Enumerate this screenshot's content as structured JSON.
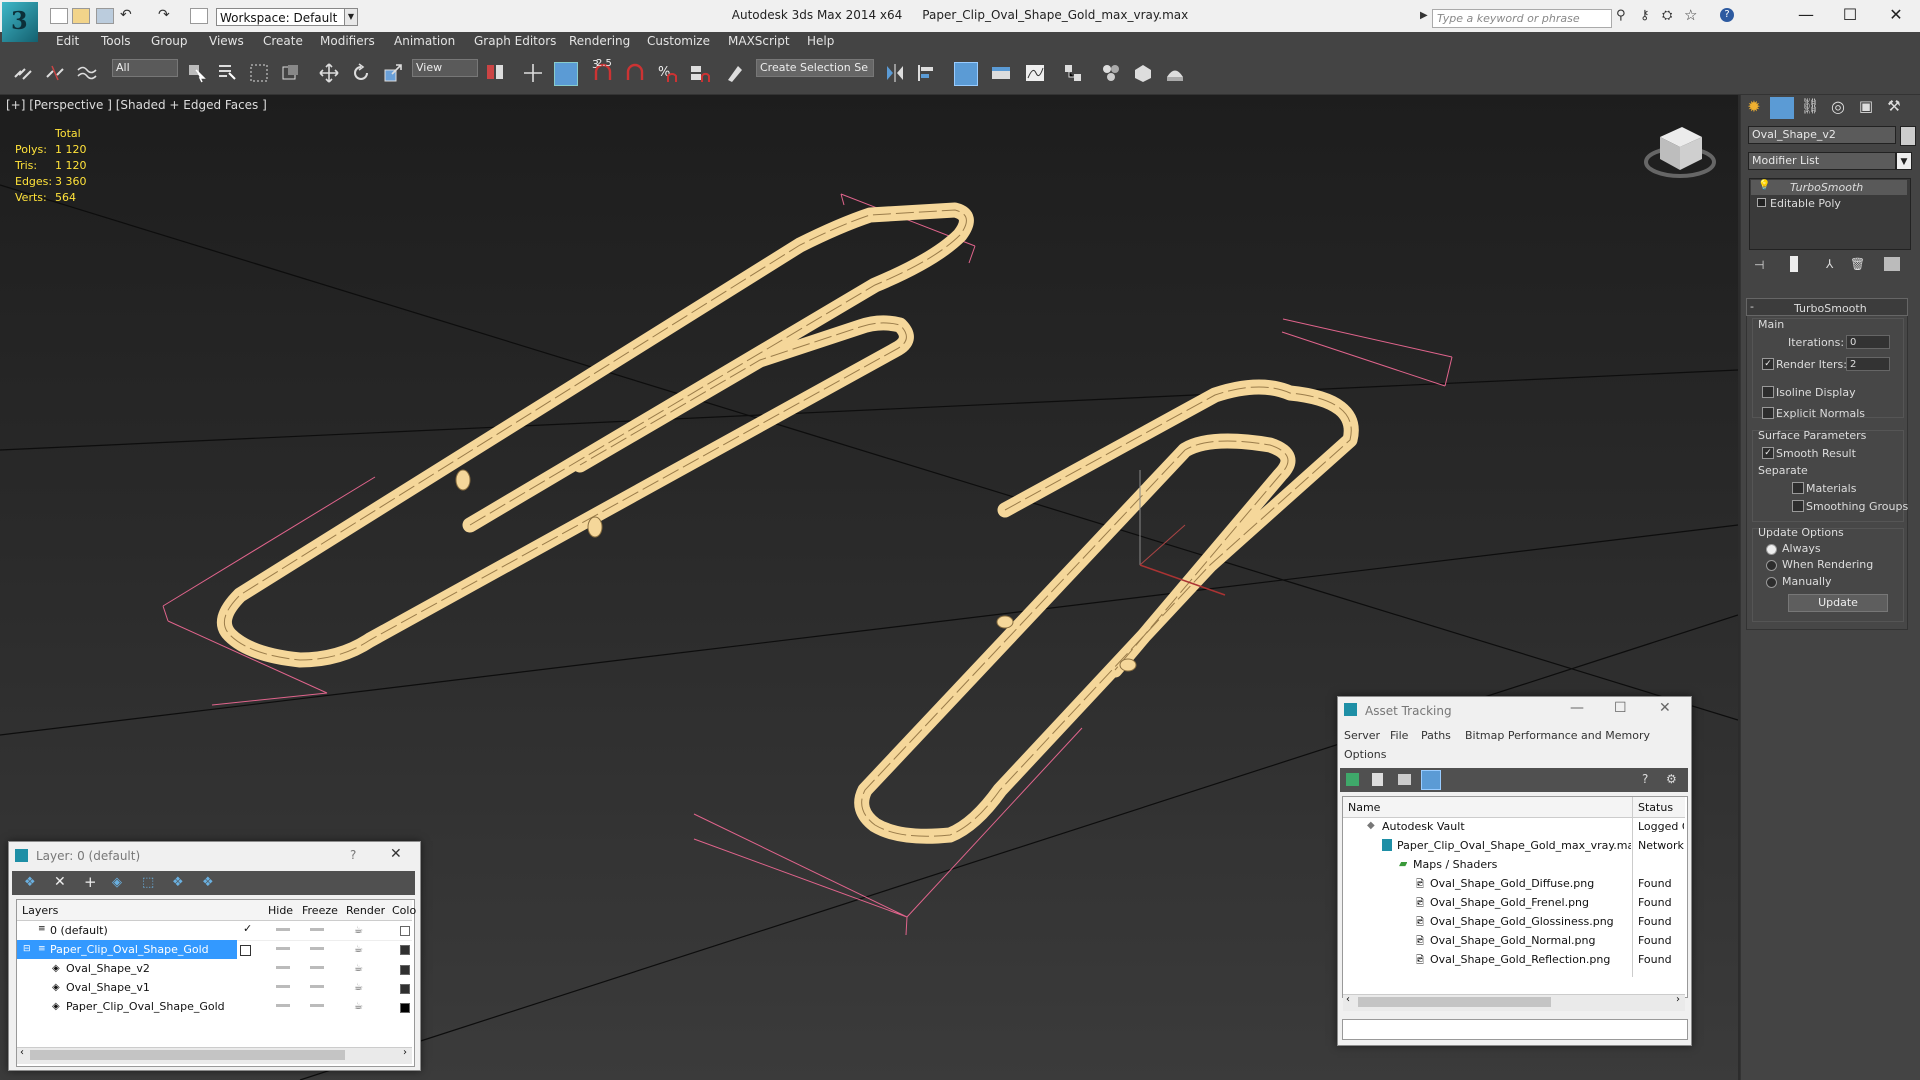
{
  "app": {
    "title": "Autodesk 3ds Max  2014 x64",
    "file": "Paper_Clip_Oval_Shape_Gold_max_vray.max",
    "logo_letter": "3"
  },
  "workspace": {
    "label": "Workspace: Default"
  },
  "search": {
    "placeholder": "Type a keyword or phrase"
  },
  "window_controls": {
    "minimize": "—",
    "maximize": "☐",
    "close": "✕"
  },
  "menu": [
    "Edit",
    "Tools",
    "Group",
    "Views",
    "Create",
    "Modifiers",
    "Animation",
    "Graph Editors",
    "Rendering",
    "Customize",
    "MAXScript",
    "Help"
  ],
  "toolbar": {
    "selection_filter": "All",
    "ref_coord": "View",
    "angle_snap": "2.5",
    "named_selection": "Create Selection Se"
  },
  "viewport": {
    "label": "[+] [Perspective ] [Shaded + Edged Faces ]",
    "stats": {
      "header": "Total",
      "rows": [
        {
          "label": "Polys:",
          "value": "1 120"
        },
        {
          "label": "Tris:",
          "value": "1 120"
        },
        {
          "label": "Edges:",
          "value": "3 360"
        },
        {
          "label": "Verts:",
          "value": "564"
        }
      ]
    },
    "clip_color": "#f5d79a",
    "box_color": "#e0648c"
  },
  "command_panel": {
    "object_name": "Oval_Shape_v2",
    "modifier_list": "Modifier List",
    "stack": [
      "TurboSmooth",
      "Editable Poly"
    ],
    "turbosmooth": {
      "title": "TurboSmooth",
      "main": "Main",
      "iterations_label": "Iterations:",
      "iterations": "0",
      "render_iters_label": "Render Iters:",
      "render_iters": "2",
      "isoline": "Isoline Display",
      "explicit": "Explicit Normals",
      "surface": "Surface Parameters",
      "smooth_result": "Smooth Result",
      "separate": "Separate",
      "materials": "Materials",
      "smoothing_groups": "Smoothing Groups",
      "update_options": "Update Options",
      "always": "Always",
      "when_rendering": "When Rendering",
      "manually": "Manually",
      "update_button": "Update"
    }
  },
  "layer_window": {
    "title": "Layer: 0 (default)",
    "help": "?",
    "close": "✕",
    "columns": [
      "Layers",
      "Hide",
      "Freeze",
      "Render",
      "Colo"
    ],
    "rows": [
      {
        "name": "0 (default)",
        "indent": 0,
        "color": "#f3a0b0",
        "selected": false,
        "current": true
      },
      {
        "name": "Paper_Clip_Oval_Shape_Gold",
        "indent": 0,
        "color": "#303030",
        "selected": true,
        "current": false
      },
      {
        "name": "Oval_Shape_v2",
        "indent": 1,
        "color": "#303030",
        "selected": false,
        "current": false
      },
      {
        "name": "Oval_Shape_v1",
        "indent": 1,
        "color": "#303030",
        "selected": false,
        "current": false
      },
      {
        "name": "Paper_Clip_Oval_Shape_Gold",
        "indent": 1,
        "color": "#000000",
        "selected": false,
        "current": false
      }
    ]
  },
  "asset_window": {
    "title": "Asset Tracking",
    "menu": [
      "Server",
      "File",
      "Paths",
      "Bitmap Performance and Memory"
    ],
    "menu2": "Options",
    "columns": [
      "Name",
      "Status"
    ],
    "rows": [
      {
        "name": "Autodesk Vault",
        "status": "Logged O",
        "indent": 0
      },
      {
        "name": "Paper_Clip_Oval_Shape_Gold_max_vray.max",
        "status": "Network",
        "indent": 1
      },
      {
        "name": "Maps / Shaders",
        "status": "",
        "indent": 2
      },
      {
        "name": "Oval_Shape_Gold_Diffuse.png",
        "status": "Found",
        "indent": 3
      },
      {
        "name": "Oval_Shape_Gold_Frenel.png",
        "status": "Found",
        "indent": 3
      },
      {
        "name": "Oval_Shape_Gold_Glossiness.png",
        "status": "Found",
        "indent": 3
      },
      {
        "name": "Oval_Shape_Gold_Normal.png",
        "status": "Found",
        "indent": 3
      },
      {
        "name": "Oval_Shape_Gold_Reflection.png",
        "status": "Found",
        "indent": 3
      }
    ]
  }
}
